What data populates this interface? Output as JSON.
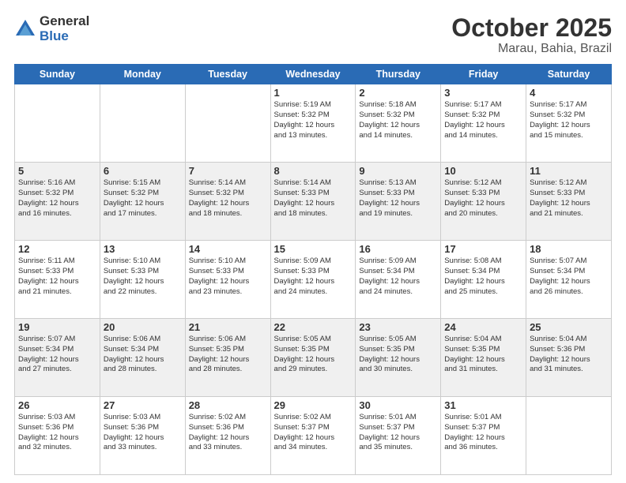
{
  "logo": {
    "general": "General",
    "blue": "Blue"
  },
  "header": {
    "month": "October 2025",
    "location": "Marau, Bahia, Brazil"
  },
  "weekdays": [
    "Sunday",
    "Monday",
    "Tuesday",
    "Wednesday",
    "Thursday",
    "Friday",
    "Saturday"
  ],
  "weeks": [
    [
      {
        "day": "",
        "info": ""
      },
      {
        "day": "",
        "info": ""
      },
      {
        "day": "",
        "info": ""
      },
      {
        "day": "1",
        "info": "Sunrise: 5:19 AM\nSunset: 5:32 PM\nDaylight: 12 hours\nand 13 minutes."
      },
      {
        "day": "2",
        "info": "Sunrise: 5:18 AM\nSunset: 5:32 PM\nDaylight: 12 hours\nand 14 minutes."
      },
      {
        "day": "3",
        "info": "Sunrise: 5:17 AM\nSunset: 5:32 PM\nDaylight: 12 hours\nand 14 minutes."
      },
      {
        "day": "4",
        "info": "Sunrise: 5:17 AM\nSunset: 5:32 PM\nDaylight: 12 hours\nand 15 minutes."
      }
    ],
    [
      {
        "day": "5",
        "info": "Sunrise: 5:16 AM\nSunset: 5:32 PM\nDaylight: 12 hours\nand 16 minutes."
      },
      {
        "day": "6",
        "info": "Sunrise: 5:15 AM\nSunset: 5:32 PM\nDaylight: 12 hours\nand 17 minutes."
      },
      {
        "day": "7",
        "info": "Sunrise: 5:14 AM\nSunset: 5:32 PM\nDaylight: 12 hours\nand 18 minutes."
      },
      {
        "day": "8",
        "info": "Sunrise: 5:14 AM\nSunset: 5:33 PM\nDaylight: 12 hours\nand 18 minutes."
      },
      {
        "day": "9",
        "info": "Sunrise: 5:13 AM\nSunset: 5:33 PM\nDaylight: 12 hours\nand 19 minutes."
      },
      {
        "day": "10",
        "info": "Sunrise: 5:12 AM\nSunset: 5:33 PM\nDaylight: 12 hours\nand 20 minutes."
      },
      {
        "day": "11",
        "info": "Sunrise: 5:12 AM\nSunset: 5:33 PM\nDaylight: 12 hours\nand 21 minutes."
      }
    ],
    [
      {
        "day": "12",
        "info": "Sunrise: 5:11 AM\nSunset: 5:33 PM\nDaylight: 12 hours\nand 21 minutes."
      },
      {
        "day": "13",
        "info": "Sunrise: 5:10 AM\nSunset: 5:33 PM\nDaylight: 12 hours\nand 22 minutes."
      },
      {
        "day": "14",
        "info": "Sunrise: 5:10 AM\nSunset: 5:33 PM\nDaylight: 12 hours\nand 23 minutes."
      },
      {
        "day": "15",
        "info": "Sunrise: 5:09 AM\nSunset: 5:33 PM\nDaylight: 12 hours\nand 24 minutes."
      },
      {
        "day": "16",
        "info": "Sunrise: 5:09 AM\nSunset: 5:34 PM\nDaylight: 12 hours\nand 24 minutes."
      },
      {
        "day": "17",
        "info": "Sunrise: 5:08 AM\nSunset: 5:34 PM\nDaylight: 12 hours\nand 25 minutes."
      },
      {
        "day": "18",
        "info": "Sunrise: 5:07 AM\nSunset: 5:34 PM\nDaylight: 12 hours\nand 26 minutes."
      }
    ],
    [
      {
        "day": "19",
        "info": "Sunrise: 5:07 AM\nSunset: 5:34 PM\nDaylight: 12 hours\nand 27 minutes."
      },
      {
        "day": "20",
        "info": "Sunrise: 5:06 AM\nSunset: 5:34 PM\nDaylight: 12 hours\nand 28 minutes."
      },
      {
        "day": "21",
        "info": "Sunrise: 5:06 AM\nSunset: 5:35 PM\nDaylight: 12 hours\nand 28 minutes."
      },
      {
        "day": "22",
        "info": "Sunrise: 5:05 AM\nSunset: 5:35 PM\nDaylight: 12 hours\nand 29 minutes."
      },
      {
        "day": "23",
        "info": "Sunrise: 5:05 AM\nSunset: 5:35 PM\nDaylight: 12 hours\nand 30 minutes."
      },
      {
        "day": "24",
        "info": "Sunrise: 5:04 AM\nSunset: 5:35 PM\nDaylight: 12 hours\nand 31 minutes."
      },
      {
        "day": "25",
        "info": "Sunrise: 5:04 AM\nSunset: 5:36 PM\nDaylight: 12 hours\nand 31 minutes."
      }
    ],
    [
      {
        "day": "26",
        "info": "Sunrise: 5:03 AM\nSunset: 5:36 PM\nDaylight: 12 hours\nand 32 minutes."
      },
      {
        "day": "27",
        "info": "Sunrise: 5:03 AM\nSunset: 5:36 PM\nDaylight: 12 hours\nand 33 minutes."
      },
      {
        "day": "28",
        "info": "Sunrise: 5:02 AM\nSunset: 5:36 PM\nDaylight: 12 hours\nand 33 minutes."
      },
      {
        "day": "29",
        "info": "Sunrise: 5:02 AM\nSunset: 5:37 PM\nDaylight: 12 hours\nand 34 minutes."
      },
      {
        "day": "30",
        "info": "Sunrise: 5:01 AM\nSunset: 5:37 PM\nDaylight: 12 hours\nand 35 minutes."
      },
      {
        "day": "31",
        "info": "Sunrise: 5:01 AM\nSunset: 5:37 PM\nDaylight: 12 hours\nand 36 minutes."
      },
      {
        "day": "",
        "info": ""
      }
    ]
  ]
}
